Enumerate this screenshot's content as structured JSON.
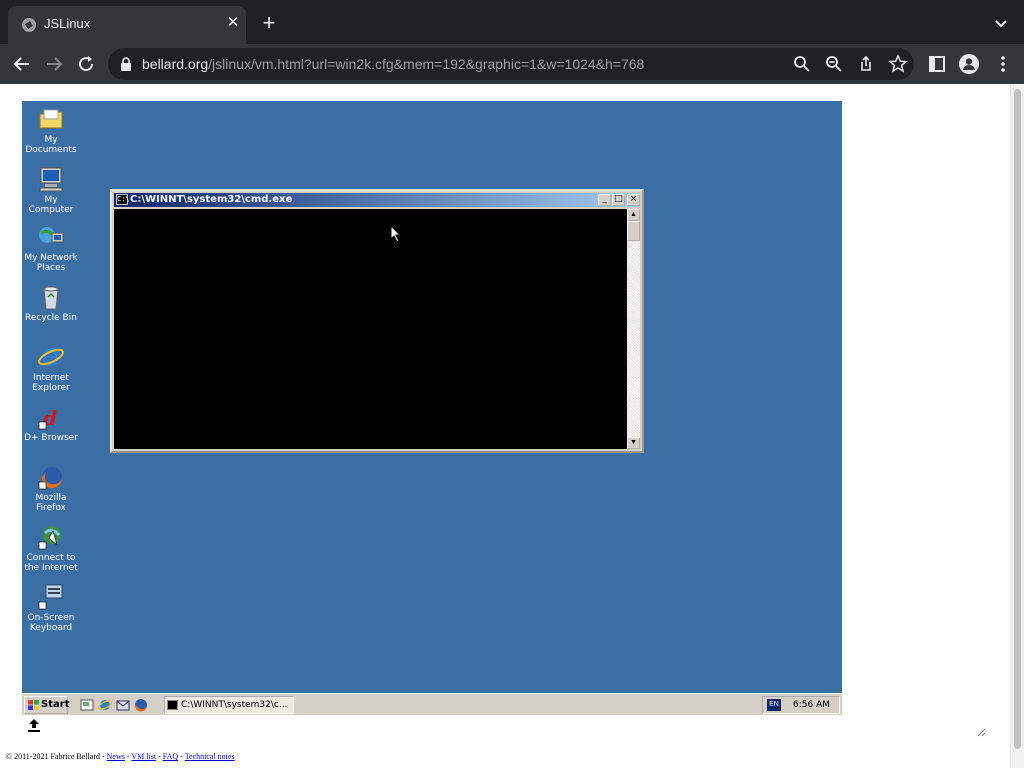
{
  "browser": {
    "tab_title": "JSLinux",
    "url_host": "bellard.org",
    "url_path": "/jslinux/vm.html?url=win2k.cfg&mem=192&graphic=1&w=1024&h=768"
  },
  "desktop": {
    "icons": [
      {
        "label": "My Documents",
        "icon": "folder-icon"
      },
      {
        "label": "My Computer",
        "icon": "computer-icon"
      },
      {
        "label": "My Network Places",
        "icon": "network-icon"
      },
      {
        "label": "Recycle Bin",
        "icon": "recycle-bin-icon"
      },
      {
        "label": "Internet Explorer",
        "icon": "ie-icon"
      },
      {
        "label": "D+ Browser",
        "icon": "dplus-icon"
      },
      {
        "label": "Mozilla Firefox",
        "icon": "firefox-icon"
      },
      {
        "label": "Connect to the Internet",
        "icon": "connect-icon"
      },
      {
        "label": "On-Screen Keyboard",
        "icon": "keyboard-icon"
      }
    ]
  },
  "cmd_window": {
    "title": "C:\\WINNT\\system32\\cmd.exe"
  },
  "taskbar": {
    "start_label": "Start",
    "task_label": "C:\\WINNT\\system32\\c...",
    "lang": "EN",
    "clock": "6:56 AM"
  },
  "footer": {
    "copyright": "© 2011-2021 Fabrice Bellard - ",
    "links": [
      "News",
      "VM list",
      "FAQ",
      "Technical notes"
    ]
  },
  "colors": {
    "desktop": "#3a6ea5",
    "titlebar_start": "#0a246a",
    "titlebar_end": "#a6caf0"
  }
}
